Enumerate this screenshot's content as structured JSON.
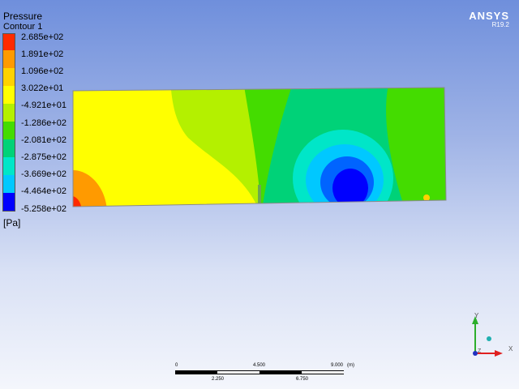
{
  "legend": {
    "variable": "Pressure",
    "name": "Contour 1",
    "unit": "[Pa]",
    "values": [
      "2.685e+02",
      "1.891e+02",
      "1.096e+02",
      "3.022e+01",
      "-4.921e+01",
      "-1.286e+02",
      "-2.081e+02",
      "-2.875e+02",
      "-3.669e+02",
      "-4.464e+02",
      "-5.258e+02"
    ],
    "colors": [
      "#ff2a00",
      "#ff9a00",
      "#ffd200",
      "#ffff00",
      "#b4f000",
      "#44dc00",
      "#00d278",
      "#00e6c8",
      "#00c8ff",
      "#0064ff",
      "#0000ff"
    ]
  },
  "logo": {
    "name": "ANSYS",
    "version": "R19.2"
  },
  "scale_bar": {
    "top_labels": [
      "0",
      "4.500",
      "9.000"
    ],
    "unit": "(m)",
    "bottom_labels": [
      "2.250",
      "6.750"
    ]
  },
  "axes": {
    "x": "X",
    "y": "Y",
    "z": "Z"
  }
}
